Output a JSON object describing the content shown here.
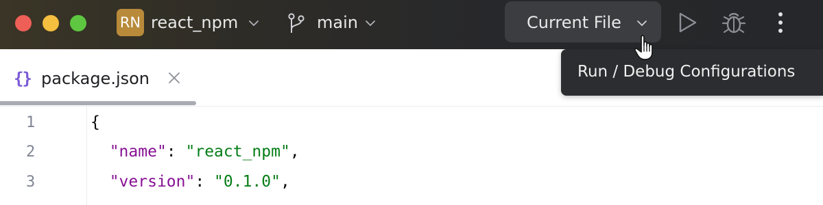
{
  "titlebar": {
    "project_badge": "RN",
    "project_name": "react_npm",
    "branch_name": "main",
    "run_config": "Current File",
    "icons": [
      "close-window",
      "minimize-window",
      "maximize-window",
      "chevron-down-icon",
      "branch-icon",
      "run-icon",
      "debug-icon",
      "more-icon"
    ],
    "colors": {
      "badge": "#b88a3a",
      "close": "#ee5f57",
      "minimize": "#f5bf3f",
      "maximize": "#5ec640"
    }
  },
  "tooltip": {
    "text": "Run / Debug Configurations"
  },
  "tab": {
    "icon_text": "{}",
    "label": "package.json"
  },
  "editor": {
    "lines": [
      {
        "number": "1",
        "text": "{"
      },
      {
        "number": "2",
        "key": "\"name\"",
        "sep": ": ",
        "value": "\"react_npm\"",
        "end": ","
      },
      {
        "number": "3",
        "key": "\"version\"",
        "sep": ": ",
        "value": "\"0.1.0\"",
        "end": ","
      }
    ],
    "colors": {
      "key": "#871094",
      "string": "#067d17"
    }
  }
}
